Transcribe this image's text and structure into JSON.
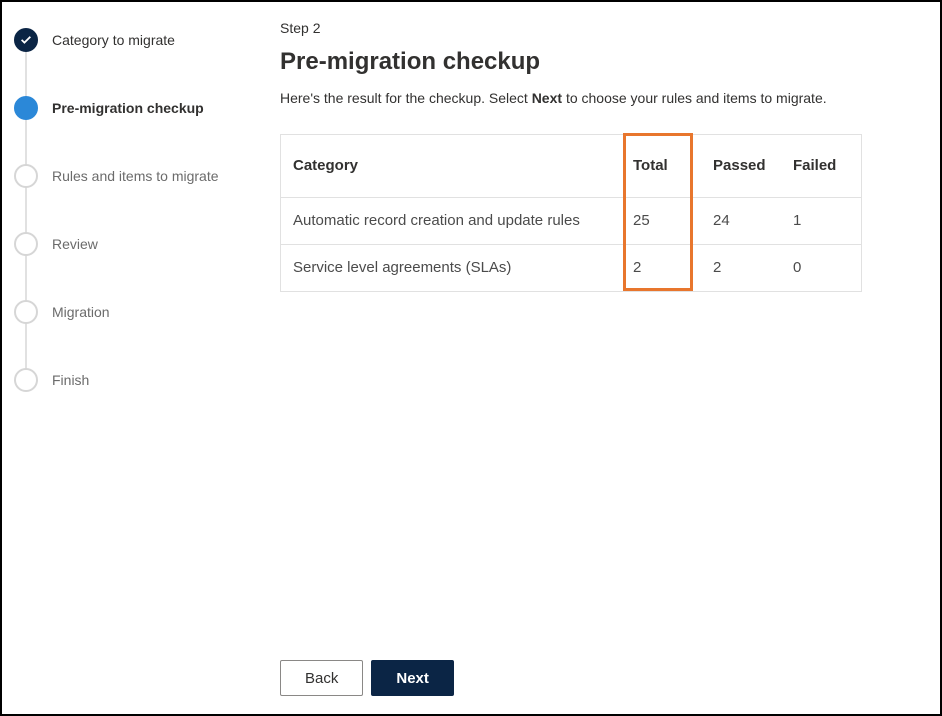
{
  "wizard": {
    "steps": [
      {
        "label": "Category to migrate",
        "state": "completed"
      },
      {
        "label": "Pre-migration checkup",
        "state": "active"
      },
      {
        "label": "Rules and items to migrate",
        "state": "upcoming"
      },
      {
        "label": "Review",
        "state": "upcoming"
      },
      {
        "label": "Migration",
        "state": "upcoming"
      },
      {
        "label": "Finish",
        "state": "upcoming"
      }
    ]
  },
  "main": {
    "step_indicator": "Step 2",
    "title": "Pre-migration checkup",
    "desc_before": "Here's the result for the checkup. Select ",
    "desc_emph": "Next",
    "desc_after": " to choose your rules and items to migrate."
  },
  "table": {
    "headers": {
      "category": "Category",
      "total": "Total",
      "passed": "Passed",
      "failed": "Failed"
    },
    "rows": [
      {
        "category": "Automatic record creation and update rules",
        "total": "25",
        "passed": "24",
        "failed": "1"
      },
      {
        "category": "Service level agreements (SLAs)",
        "total": "2",
        "passed": "2",
        "failed": "0"
      }
    ],
    "highlighted_column": "total"
  },
  "footer": {
    "back_label": "Back",
    "next_label": "Next"
  }
}
